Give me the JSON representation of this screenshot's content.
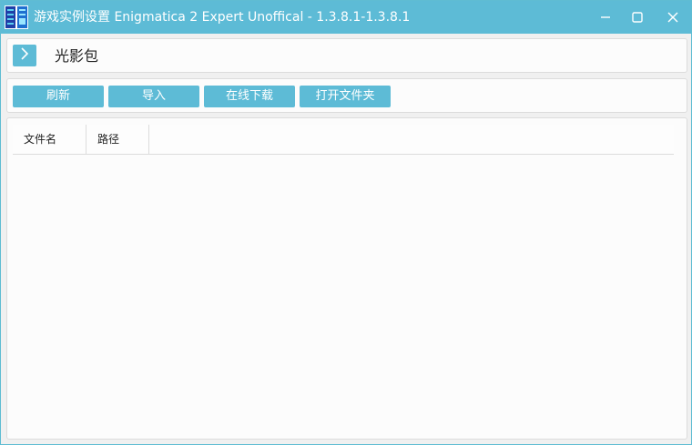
{
  "window": {
    "title": "游戏实例设置 Enigmatica 2 Expert Unoffical - 1.3.8.1-1.3.8.1",
    "accent_color": "#5dbbd6",
    "app_icon": "hmcl-launcher-icon",
    "controls": {
      "minimize": "minimize-icon",
      "maximize": "maximize-icon",
      "close": "close-icon"
    }
  },
  "header": {
    "back_icon": "chevron-right-icon",
    "title": "光影包"
  },
  "toolbar": {
    "refresh_label": "刷新",
    "import_label": "导入",
    "online_download_label": "在线下载",
    "open_folder_label": "打开文件夹"
  },
  "table": {
    "columns": [
      "文件名",
      "路径"
    ],
    "rows": []
  }
}
